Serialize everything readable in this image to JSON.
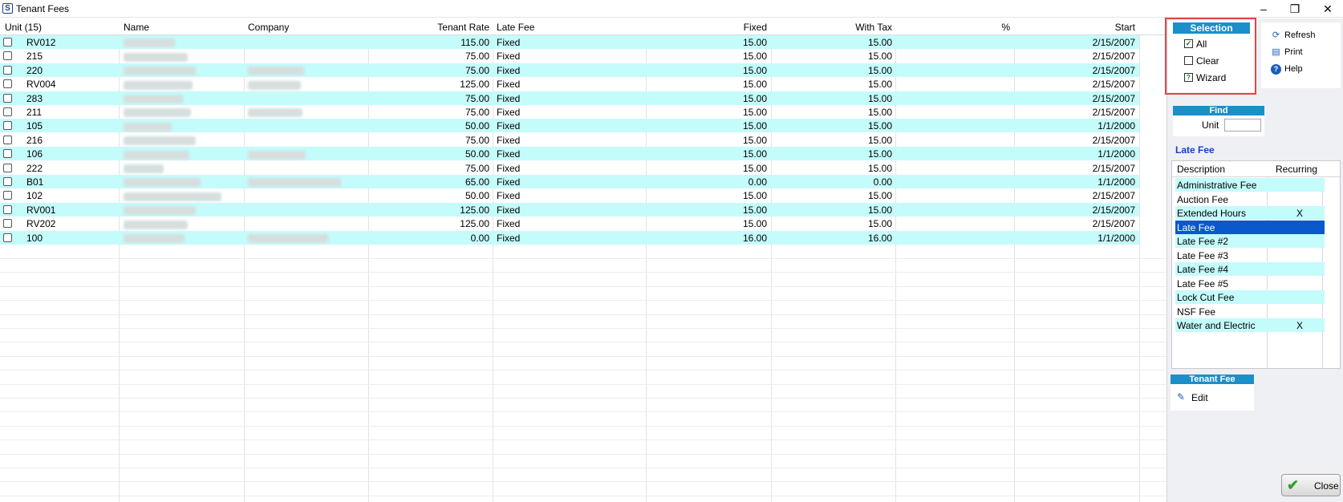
{
  "window": {
    "title": "Tenant Fees",
    "app_icon": "S"
  },
  "grid": {
    "headers": {
      "unit": "Unit (15)",
      "name": "Name",
      "company": "Company",
      "tenant_rate": "Tenant Rate",
      "late_fee": "Late Fee",
      "fixed": "Fixed",
      "with_tax": "With Tax",
      "percent": "%",
      "start": "Start"
    },
    "rows": [
      {
        "unit": "RV012",
        "tenant_rate": "115.00",
        "late_fee": "Fixed",
        "fixed": "15.00",
        "with_tax": "15.00",
        "start": "2/15/2007"
      },
      {
        "unit": "215",
        "tenant_rate": "75.00",
        "late_fee": "Fixed",
        "fixed": "15.00",
        "with_tax": "15.00",
        "start": "2/15/2007"
      },
      {
        "unit": "220",
        "tenant_rate": "75.00",
        "late_fee": "Fixed",
        "fixed": "15.00",
        "with_tax": "15.00",
        "start": "2/15/2007"
      },
      {
        "unit": "RV004",
        "tenant_rate": "125.00",
        "late_fee": "Fixed",
        "fixed": "15.00",
        "with_tax": "15.00",
        "start": "2/15/2007"
      },
      {
        "unit": "283",
        "tenant_rate": "75.00",
        "late_fee": "Fixed",
        "fixed": "15.00",
        "with_tax": "15.00",
        "start": "2/15/2007"
      },
      {
        "unit": "211",
        "tenant_rate": "75.00",
        "late_fee": "Fixed",
        "fixed": "15.00",
        "with_tax": "15.00",
        "start": "2/15/2007"
      },
      {
        "unit": "105",
        "tenant_rate": "50.00",
        "late_fee": "Fixed",
        "fixed": "15.00",
        "with_tax": "15.00",
        "start": "1/1/2000"
      },
      {
        "unit": "216",
        "tenant_rate": "75.00",
        "late_fee": "Fixed",
        "fixed": "15.00",
        "with_tax": "15.00",
        "start": "2/15/2007"
      },
      {
        "unit": "106",
        "tenant_rate": "50.00",
        "late_fee": "Fixed",
        "fixed": "15.00",
        "with_tax": "15.00",
        "start": "1/1/2000"
      },
      {
        "unit": "222",
        "tenant_rate": "75.00",
        "late_fee": "Fixed",
        "fixed": "15.00",
        "with_tax": "15.00",
        "start": "2/15/2007"
      },
      {
        "unit": "B01",
        "tenant_rate": "65.00",
        "late_fee": "Fixed",
        "fixed": "0.00",
        "with_tax": "0.00",
        "start": "1/1/2000"
      },
      {
        "unit": "102",
        "tenant_rate": "50.00",
        "late_fee": "Fixed",
        "fixed": "15.00",
        "with_tax": "15.00",
        "start": "2/15/2007"
      },
      {
        "unit": "RV001",
        "tenant_rate": "125.00",
        "late_fee": "Fixed",
        "fixed": "15.00",
        "with_tax": "15.00",
        "start": "2/15/2007"
      },
      {
        "unit": "RV202",
        "tenant_rate": "125.00",
        "late_fee": "Fixed",
        "fixed": "15.00",
        "with_tax": "15.00",
        "start": "2/15/2007"
      },
      {
        "unit": "100",
        "tenant_rate": "0.00",
        "late_fee": "Fixed",
        "fixed": "16.00",
        "with_tax": "16.00",
        "start": "1/1/2000"
      }
    ]
  },
  "selection": {
    "title": "Selection",
    "all": "All",
    "clear": "Clear",
    "wizard": "Wizard"
  },
  "actions": {
    "refresh": "Refresh",
    "print": "Print",
    "help": "Help"
  },
  "find": {
    "title": "Find",
    "unit_label": "Unit",
    "unit_value": ""
  },
  "late_fee_panel": {
    "title": "Late Fee",
    "headers": {
      "description": "Description",
      "recurring": "Recurring"
    },
    "items": [
      {
        "description": "Administrative Fee",
        "recurring": ""
      },
      {
        "description": "Auction Fee",
        "recurring": ""
      },
      {
        "description": "Extended Hours",
        "recurring": "X"
      },
      {
        "description": "Late Fee",
        "recurring": ""
      },
      {
        "description": "Late Fee #2",
        "recurring": ""
      },
      {
        "description": "Late Fee #3",
        "recurring": ""
      },
      {
        "description": "Late Fee #4",
        "recurring": ""
      },
      {
        "description": "Late Fee #5",
        "recurring": ""
      },
      {
        "description": "Lock Cut Fee",
        "recurring": ""
      },
      {
        "description": "NSF Fee",
        "recurring": ""
      },
      {
        "description": "Water and Electric",
        "recurring": "X"
      }
    ],
    "selected_index": 3
  },
  "tenant_fee": {
    "title": "Tenant Fee",
    "edit": "Edit"
  },
  "close_label": "Close",
  "colors": {
    "row_alt": "#c4fbfb",
    "panel_title": "#1b8fc9",
    "selected": "#0a58c9",
    "highlight_box": "#e04545"
  }
}
